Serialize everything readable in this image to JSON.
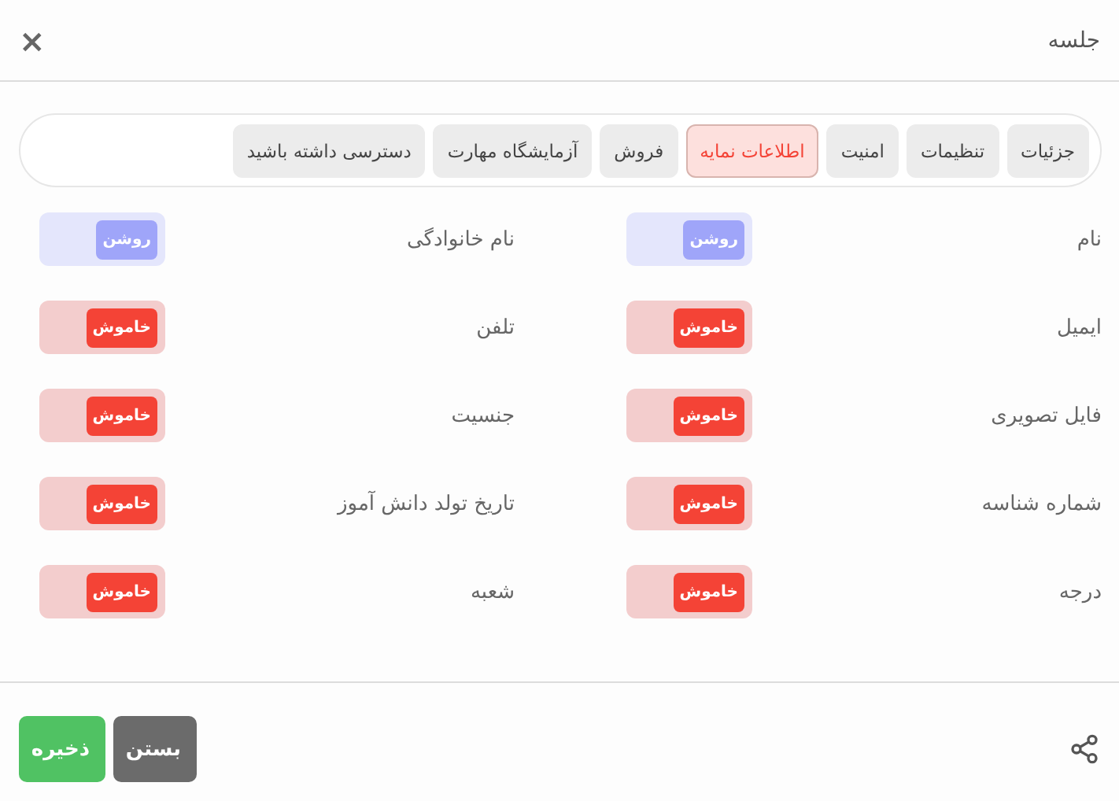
{
  "dialog": {
    "title": "جلسه",
    "close": "×"
  },
  "tabs": [
    {
      "label": "جزئیات",
      "selected": false
    },
    {
      "label": "تنظیمات",
      "selected": false
    },
    {
      "label": "امنیت",
      "selected": false
    },
    {
      "label": "اطلاعات نمایه",
      "selected": true
    },
    {
      "label": "فروش",
      "selected": false
    },
    {
      "label": "آزمایشگاه مهارت",
      "selected": false
    },
    {
      "label": "دسترسی داشته باشید",
      "selected": false
    }
  ],
  "fields": [
    {
      "label": "نام",
      "on": true,
      "toggle_text": "روشن"
    },
    {
      "label": "نام خانوادگی",
      "on": true,
      "toggle_text": "روشن"
    },
    {
      "label": "ایمیل",
      "on": false,
      "toggle_text": "خاموش"
    },
    {
      "label": "تلفن",
      "on": false,
      "toggle_text": "خاموش"
    },
    {
      "label": "فایل تصویری",
      "on": false,
      "toggle_text": "خاموش"
    },
    {
      "label": "جنسیت",
      "on": false,
      "toggle_text": "خاموش"
    },
    {
      "label": "شماره شناسه",
      "on": false,
      "toggle_text": "خاموش"
    },
    {
      "label": "تاریخ تولد دانش آموز",
      "on": false,
      "toggle_text": "خاموش"
    },
    {
      "label": "درجه",
      "on": false,
      "toggle_text": "خاموش"
    },
    {
      "label": "شعبه",
      "on": false,
      "toggle_text": "خاموش"
    }
  ],
  "footer": {
    "buttons": [
      {
        "label": "بستن",
        "kind": "close"
      },
      {
        "label": "ذخیره",
        "kind": "save"
      }
    ]
  }
}
